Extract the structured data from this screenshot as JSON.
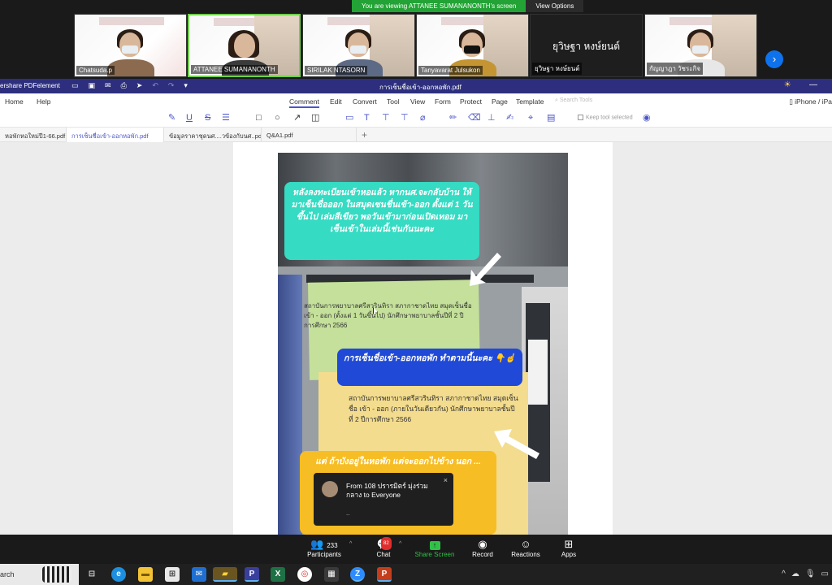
{
  "zoom": {
    "viewing_message": "You are viewing ATTANEE SUMANANONTH's screen",
    "view_options": "View Options",
    "participants_gallery": [
      {
        "name": "Chatsuda.p"
      },
      {
        "name": "ATTANEE SUMANANONTH"
      },
      {
        "name": "SIRILAK NTASORN"
      },
      {
        "name": "Tanyavarat Julsukon"
      },
      {
        "name": "ยุวิษฐา หงษ์ยนต์",
        "display_name": "ยุวิษฐา หงษ์ยนต์"
      },
      {
        "name": "กัญญาฎา วัชระกิจ"
      }
    ],
    "next_icon": "chevron-right-icon",
    "bottom": {
      "participants_label": "Participants",
      "participants_count": "233",
      "chat_label": "Chat",
      "chat_badge": "82",
      "share_label": "Share Screen",
      "record_label": "Record",
      "reactions_label": "Reactions",
      "apps_label": "Apps"
    },
    "chat_toast": {
      "text": "From 108 ปรารมิตร์ มุ่งร่วมกลาง to Everyone",
      "preview": "..",
      "close": "×"
    }
  },
  "pdfelement": {
    "app_name": "ershare PDFelement",
    "doc_title": "การเซ็นชื่อเข้า-ออกหอพัก.pdf",
    "menu": {
      "home": "Home",
      "help": "Help",
      "comment": "Comment",
      "edit": "Edit",
      "convert": "Convert",
      "tool": "Tool",
      "view": "View",
      "form": "Form",
      "protect": "Protect",
      "page": "Page",
      "template": "Template",
      "search_placeholder": "Search Tools",
      "device": "iPhone / iPa"
    },
    "keep_tool_selected": "Keep tool selected",
    "tabs": [
      "หอพักหอใหม่ปี1-66.pdf",
      "การเซ็นชื่อเข้า-ออกหอพัก.pdf",
      "ข้อมูลราคาชุดนศ....วข้องกับนศ..pdf",
      "Q&A1.pdf"
    ],
    "tab_add": "+",
    "photo": {
      "overlay_top": "หลังลงทะเบียนเข้าหอแล้ว หากนศ.จะกลับบ้าน ให้มาเซ็นชื่อออก ในสมุดเซนชื่นเข้า-ออก ตั้งแต่ 1 วันขึ้นไป เล่มสีเขียว พอวันเข้ามาก่อนเปิดเทอม มาเซ็นเข้าในเล่มนี้เช่นกันนะคะ",
      "green_book_text": "สถาบันการพยาบาลศรีสวรินทิรา สภากาชาดไทย สมุดเซ็นชื่อ เข้า - ออก (ตั้งแต่ 1 วันขึ้นไป) นักศึกษาพยาบาลชั้นปีที่ 2 ปีการศึกษา 2566",
      "overlay_mid": "การเซ็นชื่อเข้า-ออกหอพัก ทำตามนี้นะคะ 👇☝️",
      "yellow_book_text": "สถาบันการพยาบาลศรีสวรินทิรา สภากาชาดไทย สมุดเซ็นชื่อ เข้า - ออก (ภายในวันเดียวกัน) นักศึกษาพยาบาลชั้นปีที่ 2 ปีการศึกษา 2566",
      "overlay_bottom": "แต่ ถ้าบังอยู่ในหอพัก แต่จะออกไปข้าง นอก ..."
    }
  },
  "taskbar": {
    "search": "arch"
  }
}
